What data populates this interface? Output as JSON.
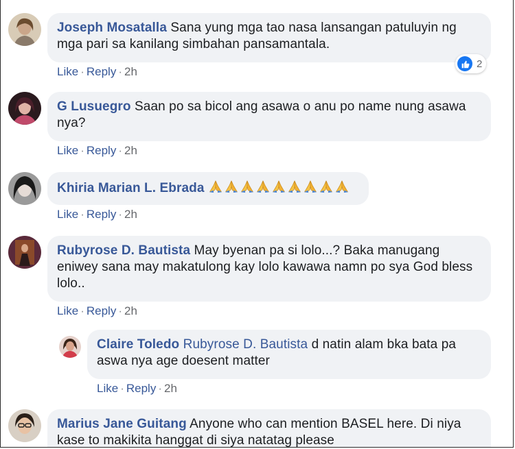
{
  "comments": [
    {
      "author": "Joseph Mosatalla",
      "text": "Sana yung mga tao nasa lansangan patuluyin ng mga pari sa kanilang simbahan pansamantala.",
      "like": "Like",
      "reply": "Reply",
      "time": "2h",
      "reaction_count": "2"
    },
    {
      "author": "G Lusuegro",
      "text": "Saan po sa bicol ang asawa o anu po name nung asawa nya?",
      "like": "Like",
      "reply": "Reply",
      "time": "2h"
    },
    {
      "author": "Khiria Marian L. Ebrada",
      "emoji_count": 9,
      "emoji": "folded-hands",
      "like": "Like",
      "reply": "Reply",
      "time": "2h"
    },
    {
      "author": "Rubyrose D. Bautista",
      "text": "May byenan pa si lolo...? Baka manugang eniwey sana may makatulong kay lolo kawawa namn po sya God bless lolo..",
      "like": "Like",
      "reply": "Reply",
      "time": "2h"
    },
    {
      "author": "Claire Toledo",
      "mention": "Rubyrose D. Bautista",
      "text": "d natin alam bka bata pa aswa nya age doesent matter",
      "like": "Like",
      "reply": "Reply",
      "time": "2h"
    },
    {
      "author": "Marius Jane Guitang",
      "text": "Anyone who can mention BASEL here. Di niya kase to makikita hanggat di siya natatag please"
    }
  ],
  "colors": {
    "author": "#385898",
    "bubble": "#f0f2f5",
    "like_icon": "#1877f2"
  }
}
